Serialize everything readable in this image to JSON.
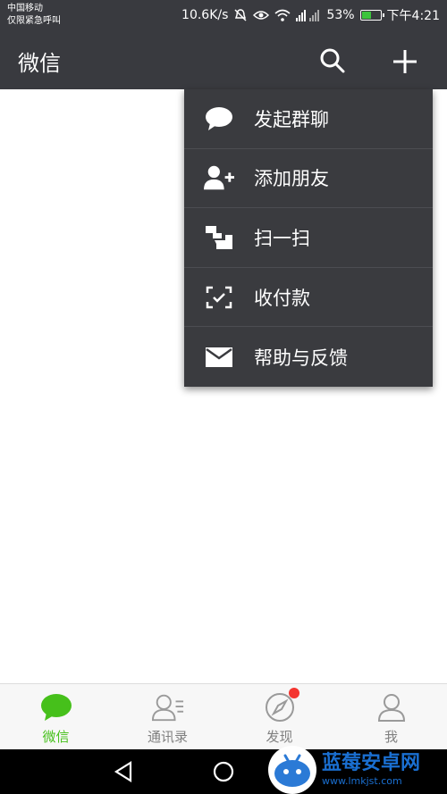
{
  "status_bar": {
    "carrier_line1": "中国移动",
    "carrier_line2": "仅限紧急呼叫",
    "speed": "10.6K/s",
    "battery_text": "53%",
    "battery_level": 0.53,
    "time": "下午4:21",
    "icons": [
      "mute-icon",
      "eye-icon",
      "wifi-icon",
      "signal-icon",
      "battery-icon"
    ]
  },
  "app_bar": {
    "title": "微信",
    "icons": [
      "search-icon",
      "plus-icon"
    ]
  },
  "menu": {
    "items": [
      {
        "label": "发起群聊",
        "icon": "chat-bubble-icon"
      },
      {
        "label": "添加朋友",
        "icon": "add-friend-icon"
      },
      {
        "label": "扫一扫",
        "icon": "scan-icon"
      },
      {
        "label": "收付款",
        "icon": "payment-icon"
      },
      {
        "label": "帮助与反馈",
        "icon": "mail-icon"
      }
    ]
  },
  "tabs": [
    {
      "label": "微信",
      "icon": "chat-icon",
      "active": true
    },
    {
      "label": "通讯录",
      "icon": "contacts-icon",
      "active": false
    },
    {
      "label": "发现",
      "icon": "compass-icon",
      "active": false,
      "badge": true
    },
    {
      "label": "我",
      "icon": "person-icon",
      "active": false
    }
  ],
  "colors": {
    "header_bg": "#393a3f",
    "menu_bg": "#3a3b3f",
    "accent_green": "#46c01b",
    "badge_red": "#f43530"
  },
  "watermark": {
    "title": "蓝莓安卓网",
    "url": "www.lmkjst.com"
  }
}
